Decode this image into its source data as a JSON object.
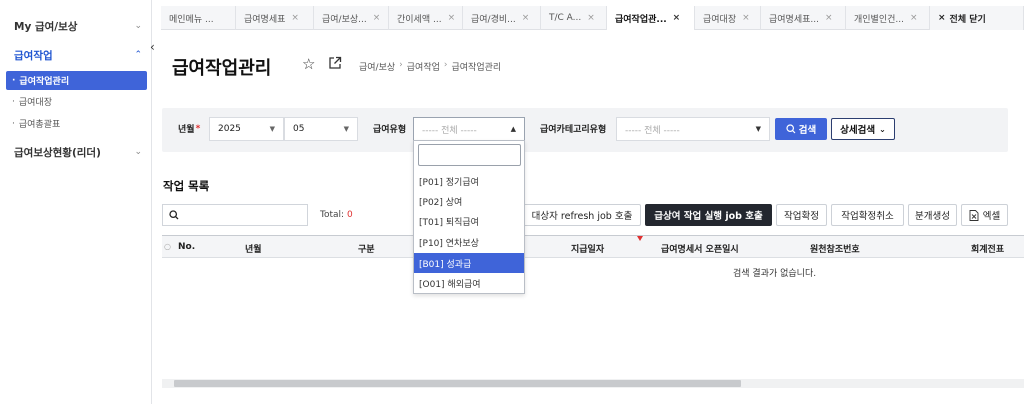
{
  "sidebar": {
    "groups": [
      {
        "label": "My 급여/보상"
      },
      {
        "label": "급여작업"
      },
      {
        "label": "급여보상현황(리더)"
      }
    ],
    "items": [
      {
        "label": "급여작업관리"
      },
      {
        "label": "급여대장"
      },
      {
        "label": "급여총괄표"
      }
    ]
  },
  "tabs": [
    {
      "label": "메인메뉴 ..."
    },
    {
      "label": "급여명세표"
    },
    {
      "label": "급여/보상..."
    },
    {
      "label": "간이세액 ..."
    },
    {
      "label": "급여/경비..."
    },
    {
      "label": "T/C A..."
    },
    {
      "label": "급여작업관..."
    },
    {
      "label": "급여대장"
    },
    {
      "label": "급여명세표..."
    },
    {
      "label": "개인별인건..."
    },
    {
      "label": "전체 닫기"
    }
  ],
  "tab_close": "×",
  "page": {
    "title": "급여작업관리",
    "breadcrumb": [
      "급여/보상",
      "급여작업",
      "급여작업관리"
    ],
    "breadcrumb_sep": "›"
  },
  "filters": {
    "year_label": "년월",
    "required_mark": "*",
    "year_value": "2025",
    "month_value": "05",
    "pay_type_label": "급여유형",
    "pay_type_value": "----- 전체 -----",
    "category_label": "급여카테고리유형",
    "category_value": "----- 전체 -----",
    "search_button": "검색",
    "advanced_button": "상세검색"
  },
  "dropdown": {
    "options": [
      "[P01] 정기급여",
      "[P02] 상여",
      "[T01] 퇴직급여",
      "[P10] 연차보상",
      "[B01] 성과급",
      "[O01] 해외급여"
    ],
    "highlighted_index": 4
  },
  "work_list": {
    "title": "작업 목록",
    "total_label": "Total:",
    "total_count": "0",
    "actions": [
      "대상자 refresh job 호출",
      "급상여 작업 실행 job 호출",
      "작업확정",
      "작업확정취소",
      "분개생성",
      "엑셀"
    ],
    "columns": [
      "No.",
      "년월",
      "구분",
      "지급일자",
      "급여명세서 오픈일시",
      "원천참조번호",
      "회계전표"
    ],
    "empty_message": "검색 결과가 없습니다."
  },
  "icons": {
    "chevron_down": "chevron-down-icon",
    "chevron_up": "chevron-up-icon",
    "star": "star-icon",
    "external_link": "external-link-icon",
    "search": "search-icon",
    "excel": "excel-icon",
    "collapse": "chevron-left-icon"
  },
  "colors": {
    "accent": "#3f64d9",
    "required": "#e03030",
    "dark_button": "#23272f"
  }
}
